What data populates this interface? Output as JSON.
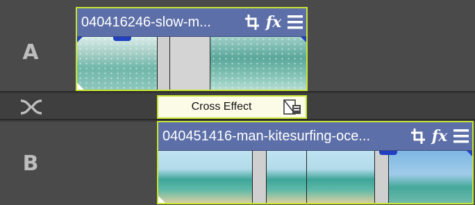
{
  "tracks": {
    "a": {
      "label": "A"
    },
    "b": {
      "label": "B"
    }
  },
  "crossfade": {
    "label": "Cross Effect",
    "icon": "transition-settings-icon"
  },
  "clips": {
    "a": {
      "title": "040416246-slow-m...",
      "icons": [
        "crop-icon",
        "fx-icon",
        "menu-icon"
      ],
      "fx_glyph": "fx"
    },
    "b": {
      "title": "040451416-man-kitesurfing-oce...",
      "icons": [
        "crop-icon",
        "fx-icon",
        "menu-icon"
      ],
      "fx_glyph": "fx"
    }
  },
  "colors": {
    "clip_border": "#c8e634",
    "clip_header": "#5d6fa8",
    "cross_bg": "#fbfbe8",
    "fade_marker": "#2040c0"
  }
}
